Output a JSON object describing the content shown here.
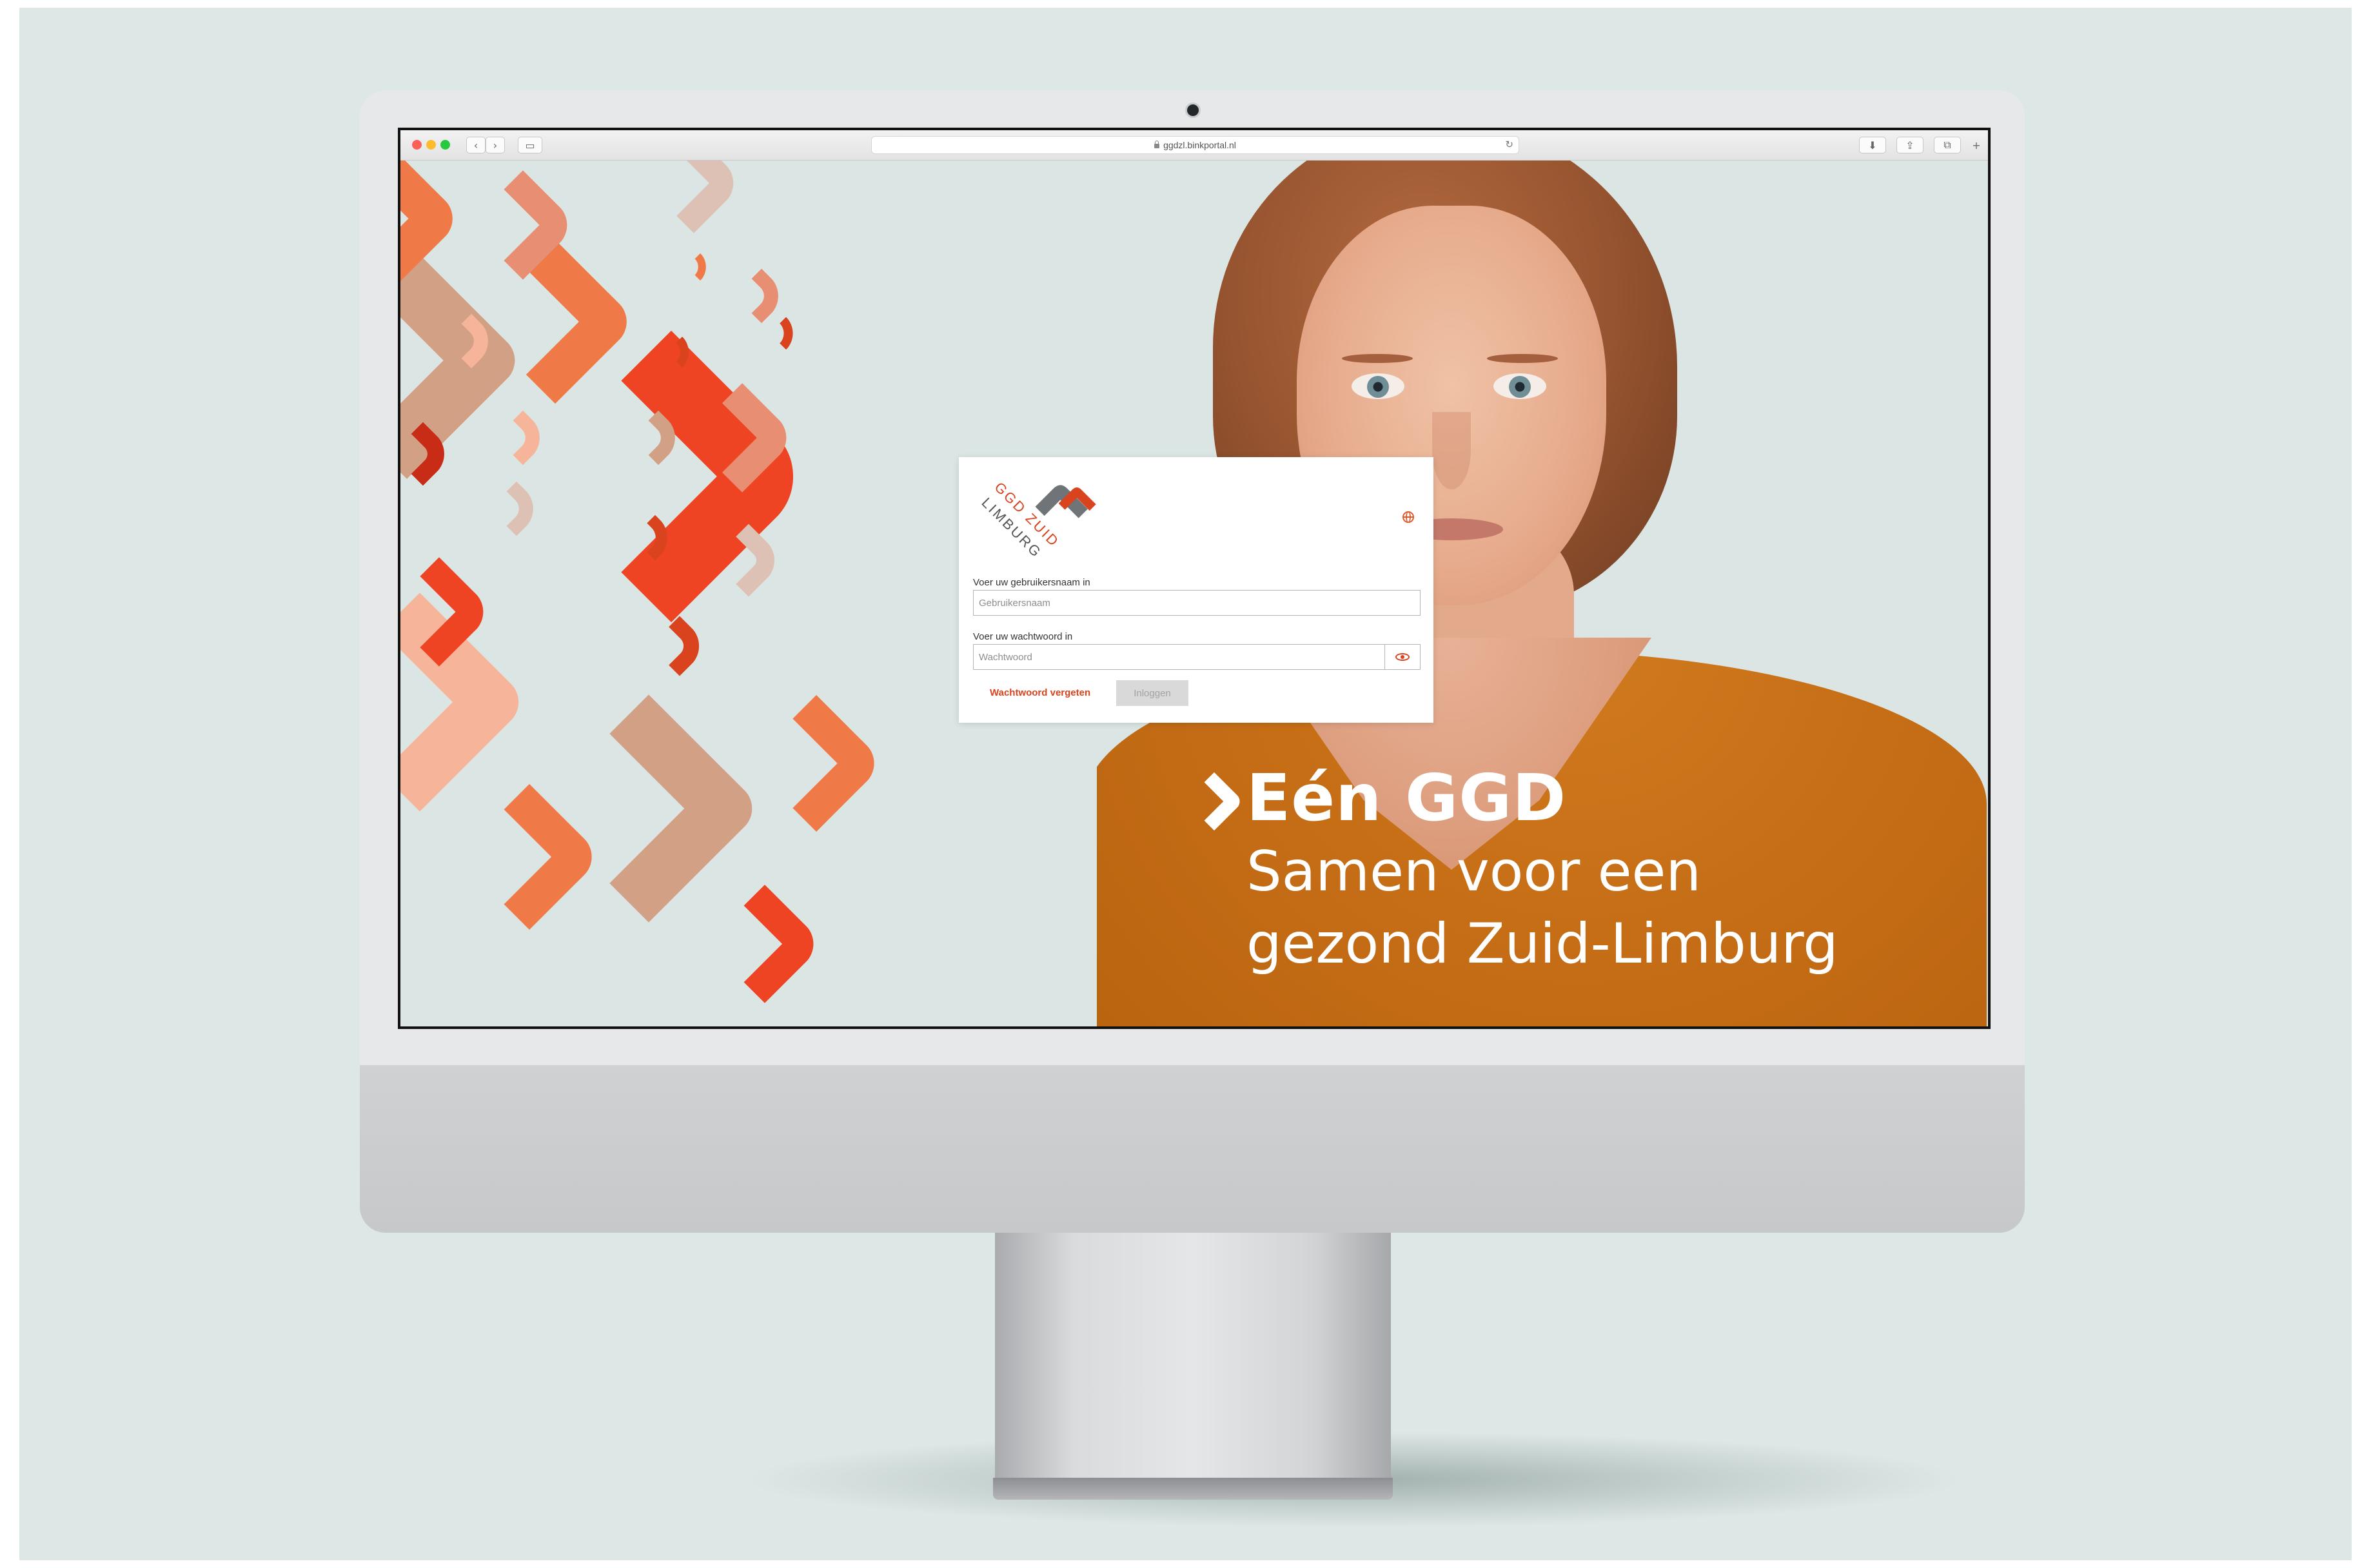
{
  "browser": {
    "url": "ggdzl.binkportal.nl"
  },
  "login": {
    "logo_text_top": "GGD ZUID",
    "logo_text_bottom": "LIMBURG",
    "username_label": "Voer uw gebruikersnaam in",
    "username_placeholder": "Gebruikersnaam",
    "username_value": "",
    "password_label": "Voer uw wachtwoord in",
    "password_placeholder": "Wachtwoord",
    "password_value": "",
    "forgot_password": "Wachtwoord vergeten",
    "login_button": "Inloggen",
    "login_enabled": false
  },
  "slogan": {
    "line1": "Eén GGD",
    "line2": "Samen voor een",
    "line3": "gezond Zuid-Limburg"
  },
  "colors": {
    "brand_orange": "#d9431e",
    "background": "#dbe6e4",
    "shirt": "#c76f17",
    "hearts": [
      "#ee4424",
      "#f07a47",
      "#e88f73",
      "#d2a085",
      "#f6b59a",
      "#dcc1b4"
    ]
  },
  "icons": [
    "lock-icon",
    "reload-icon",
    "globe-icon",
    "eye-icon",
    "chevron-left-icon",
    "chevron-right-icon",
    "sidebar-icon",
    "download-icon",
    "share-icon",
    "tabs-icon",
    "plus-icon",
    "heart-logo-icon"
  ]
}
